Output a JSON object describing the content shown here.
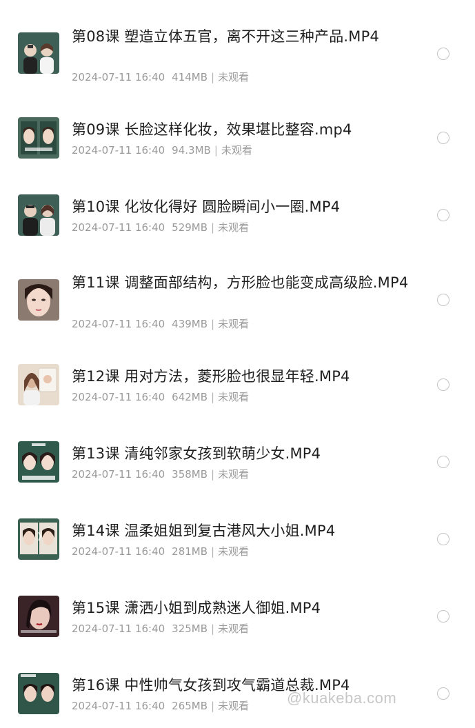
{
  "files": [
    {
      "title": "第08课 塑造立体五官，离不开这三种产品.MP4",
      "date": "2024-07-11 16:40",
      "size": "414MB",
      "status": "未观看",
      "thumb_bg": "#3e5f55",
      "thumb_fg": "#e8d2c2"
    },
    {
      "title": "第09课 长脸这样化妆，效果堪比整容.mp4",
      "date": "2024-07-11 16:40",
      "size": "94.3MB",
      "status": "未观看",
      "thumb_bg": "#4a6a5e",
      "thumb_fg": "#f0d8c8"
    },
    {
      "title": "第10课 化妆化得好 圆脸瞬间小一圈.MP4",
      "date": "2024-07-11 16:40",
      "size": "529MB",
      "status": "未观看",
      "thumb_bg": "#3e5f55",
      "thumb_fg": "#e6cfbf"
    },
    {
      "title": "第11课 调整面部结构，方形脸也能变成高级脸.MP4",
      "date": "2024-07-11 16:40",
      "size": "439MB",
      "status": "未观看",
      "thumb_bg": "#8a7a70",
      "thumb_fg": "#f2d9cc"
    },
    {
      "title": "第12课 用对方法，菱形脸也很显年轻.MP4",
      "date": "2024-07-11 16:40",
      "size": "642MB",
      "status": "未观看",
      "thumb_bg": "#e8dccf",
      "thumb_fg": "#d9b49a"
    },
    {
      "title": "第13课 清纯邻家女孩到软萌少女.MP4",
      "date": "2024-07-11 16:40",
      "size": "358MB",
      "status": "未观看",
      "thumb_bg": "#2f5a4c",
      "thumb_fg": "#f1dccf"
    },
    {
      "title": "第14课 温柔姐姐到复古港风大小姐.MP4",
      "date": "2024-07-11 16:40",
      "size": "281MB",
      "status": "未观看",
      "thumb_bg": "#3b6152",
      "thumb_fg": "#efd6c6"
    },
    {
      "title": "第15课 潇洒小姐到成熟迷人御姐.MP4",
      "date": "2024-07-11 16:40",
      "size": "325MB",
      "status": "未观看",
      "thumb_bg": "#3a2428",
      "thumb_fg": "#e9c9bd"
    },
    {
      "title": "第16课 中性帅气女孩到攻气霸道总裁.MP4",
      "date": "2024-07-11 16:40",
      "size": "265MB",
      "status": "未观看",
      "thumb_bg": "#30564a",
      "thumb_fg": "#ecd3c3"
    }
  ],
  "watermark": "@kuakeba.com"
}
